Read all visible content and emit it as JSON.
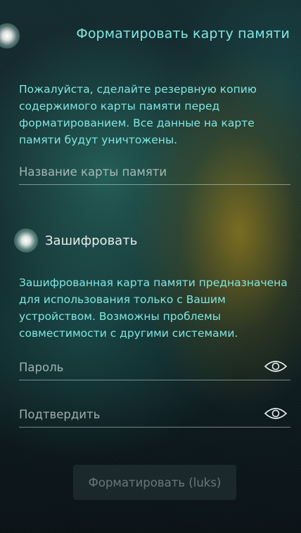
{
  "header": {
    "title": "Форматировать карту памяти",
    "pulley_icon": "glow-dot"
  },
  "warning_text": "Пожалуйста, сделайте резервную копию содержимого карты памяти перед форматированием. Все данные на карте памяти будут уничтожены.",
  "card_name": {
    "placeholder": "Название карты памяти",
    "value": ""
  },
  "encrypt": {
    "label": "Зашифровать",
    "checked": true,
    "info": "Зашифрованная карта памяти предназначена для использования только с Вашим устройством. Возможны проблемы совместимости с другими системами."
  },
  "password": {
    "placeholder": "Пароль",
    "value": "",
    "icon": "eye-icon"
  },
  "confirm": {
    "placeholder": "Подтвердить",
    "value": "",
    "icon": "eye-icon"
  },
  "format_button": {
    "label": "Форматировать (luks)",
    "enabled": false
  },
  "colors": {
    "accent": "#7fe6e0",
    "text_primary": "#e6efef"
  }
}
